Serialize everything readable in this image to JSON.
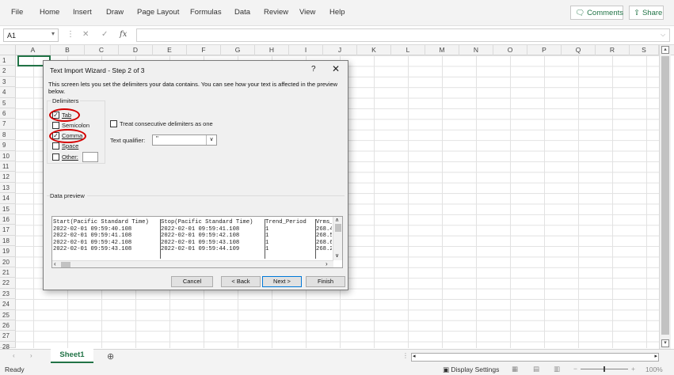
{
  "ribbon": {
    "tabs": [
      "File",
      "Home",
      "Insert",
      "Draw",
      "Page Layout",
      "Formulas",
      "Data",
      "Review",
      "View",
      "Help"
    ],
    "comments": "Comments",
    "share": "Share"
  },
  "formula_bar": {
    "name_box": "A1",
    "fx": "fx",
    "formula": ""
  },
  "grid": {
    "columns": [
      "A",
      "B",
      "C",
      "D",
      "E",
      "F",
      "G",
      "H",
      "I",
      "J",
      "K",
      "L",
      "M",
      "N",
      "O",
      "P",
      "Q",
      "R",
      "S"
    ],
    "rows": [
      "1",
      "2",
      "3",
      "4",
      "5",
      "6",
      "7",
      "8",
      "9",
      "10",
      "11",
      "12",
      "13",
      "14",
      "15",
      "16",
      "17",
      "18",
      "19",
      "20",
      "21",
      "22",
      "23",
      "24",
      "25",
      "26",
      "27",
      "28"
    ],
    "selected_cell": "A1"
  },
  "dialog": {
    "title": "Text Import Wizard - Step 2 of 3",
    "help": "?",
    "close": "✕",
    "description": "This screen lets you set the delimiters your data contains.  You can see how your text is affected in the preview below.",
    "delimiters_title": "Delimiters",
    "delimiters": [
      {
        "label": "Tab",
        "checked": true
      },
      {
        "label": "Semicolon",
        "checked": false
      },
      {
        "label": "Comma",
        "checked": true
      },
      {
        "label": "Space",
        "checked": false
      },
      {
        "label": "Other:",
        "checked": false
      }
    ],
    "consecutive_label": "Treat consecutive delimiters as one",
    "consecutive_checked": false,
    "qualifier_label": "Text qualifier:",
    "qualifier_value": "\"",
    "data_preview_label": "Data preview",
    "preview_rows": [
      [
        "Start(Pacific Standard Time)",
        "Stop(Pacific Standard Time)",
        "Trend_Period",
        "Vrms_"
      ],
      [
        "2022-02-01 09:59:40.108",
        "2022-02-01 09:59:41.108",
        "1",
        "268.4"
      ],
      [
        "2022-02-01 09:59:41.108",
        "2022-02-01 09:59:42.108",
        "1",
        "268.5"
      ],
      [
        "2022-02-01 09:59:42.108",
        "2022-02-01 09:59:43.108",
        "1",
        "268.6"
      ],
      [
        "2022-02-01 09:59:43.108",
        "2022-02-01 09:59:44.109",
        "1",
        "268.2"
      ]
    ],
    "buttons": {
      "cancel": "Cancel",
      "back": "< Back",
      "next": "Next >",
      "finish": "Finish"
    }
  },
  "sheets": {
    "active": "Sheet1",
    "add": "⊕"
  },
  "status": {
    "ready": "Ready",
    "display_settings": "Display Settings",
    "zoom": "100%"
  },
  "colors": {
    "excel_green": "#217346",
    "annotation_red": "#d40000"
  }
}
